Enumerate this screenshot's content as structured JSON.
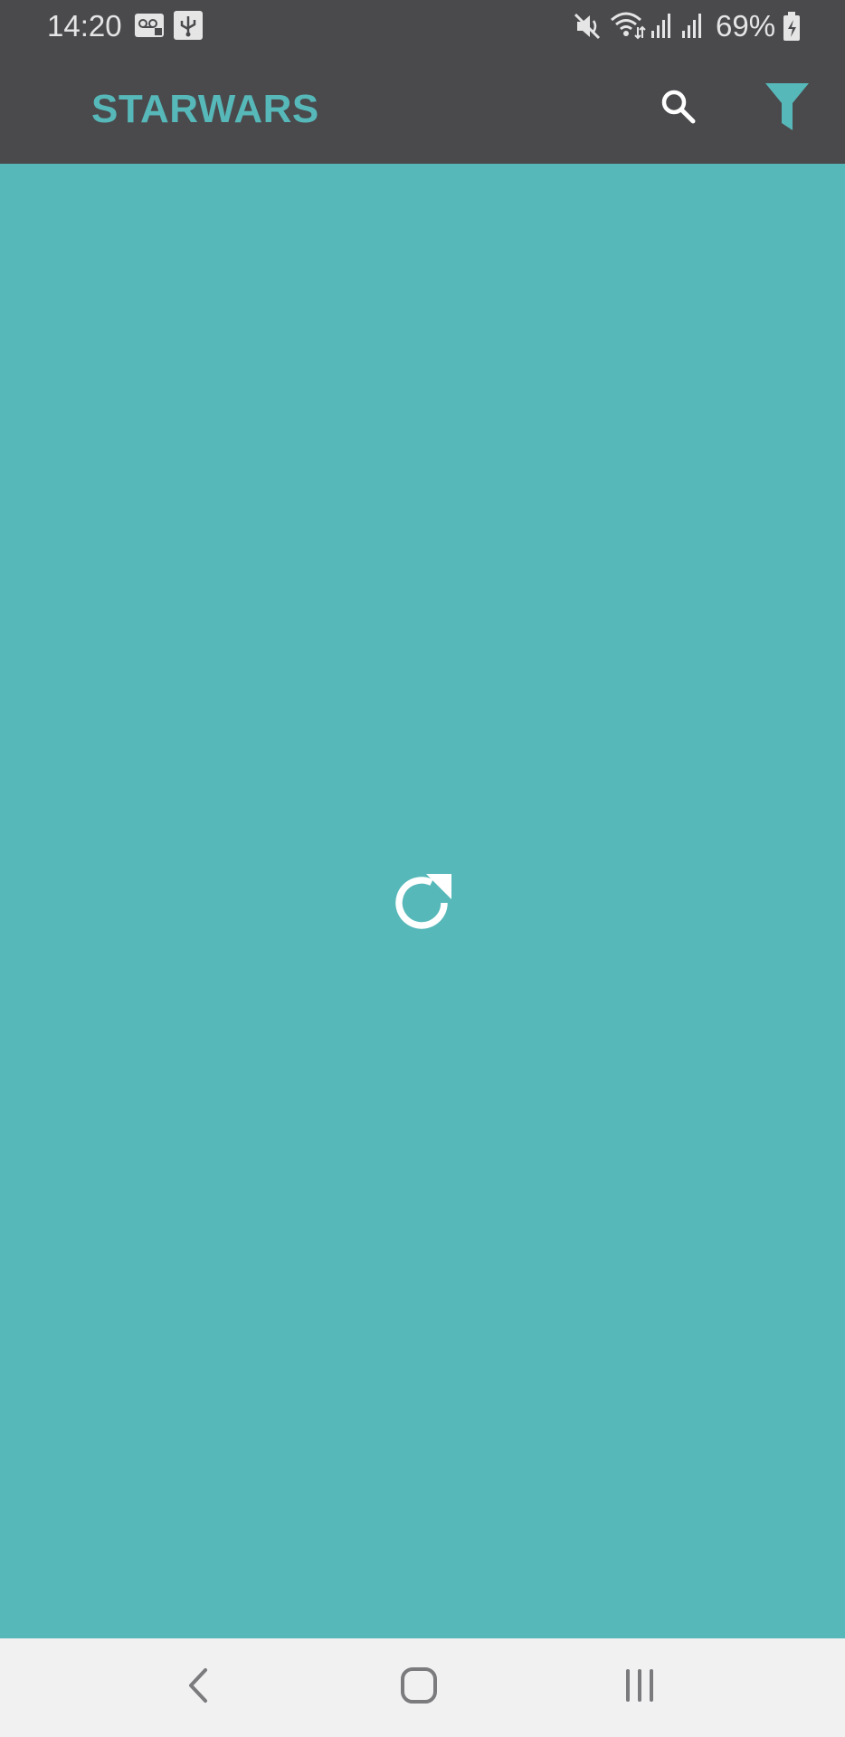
{
  "status_bar": {
    "time": "14:20",
    "battery": "69%",
    "icons": [
      "voicemail-icon",
      "usb-icon",
      "mute-icon",
      "wifi-icon",
      "signal-icon",
      "signal-icon",
      "battery-charging-icon"
    ]
  },
  "app_bar": {
    "title": "STARWARS",
    "actions": [
      "search-icon",
      "filter-icon"
    ]
  },
  "content": {
    "center_icon": "refresh-icon"
  },
  "nav_bar": {
    "buttons": [
      "back-icon",
      "home-icon",
      "recents-icon"
    ]
  },
  "colors": {
    "accent": "#57b8b9",
    "toolbar": "#4a494c",
    "nav_background": "#f1f1f2"
  }
}
